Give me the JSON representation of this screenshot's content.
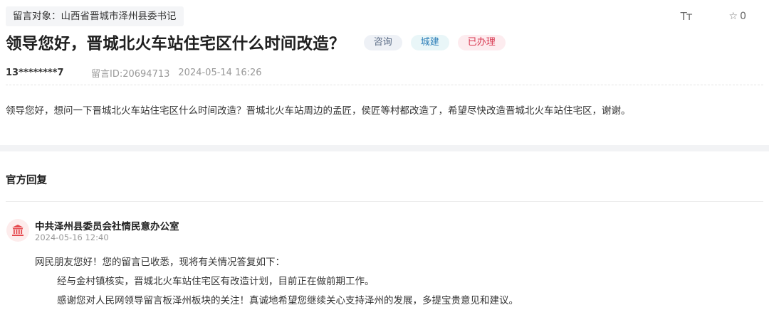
{
  "message": {
    "target_label": "留言对象：山西省晋城市泽州县委书记",
    "title": "领导您好，晋城北火车站住宅区什么时间改造？",
    "tags": {
      "type": "咨询",
      "domain": "城建",
      "status": "已办理"
    },
    "author": "13********7",
    "message_id": "留言ID:20694713",
    "timestamp": "2024-05-14 16:26",
    "content": "领导您好，想问一下晋城北火车站住宅区什么时间改造？晋城北火车站周边的孟匠，侯匠等村都改造了，希望尽快改造晋城北火车站住宅区，谢谢。",
    "favorite_count": "0",
    "icons": [
      "font-size-icon",
      "star-icon"
    ]
  },
  "reply": {
    "section_title": "官方回复",
    "office": "中共泽州县委员会社情民意办公室",
    "time": "2024-05-16 12:40",
    "avatar_icon": "government-building-icon",
    "paragraphs": [
      "网民朋友您好！您的留言已收悉，现将有关情况答复如下：",
      "经与金村镇核实，晋城北火车站住宅区有改造计划，目前正在做前期工作。",
      "感谢您对人民网领导留言板泽州板块的关注！真诚地希望您继续关心支持泽州的发展，多提宝贵意见和建议。"
    ]
  },
  "colors": {
    "status_red": "#d8364f",
    "domain_blue": "#2e7fb8",
    "type_gray": "#5a6b85",
    "avatar_bg": "#fdecec",
    "avatar_fg": "#e5484d"
  }
}
